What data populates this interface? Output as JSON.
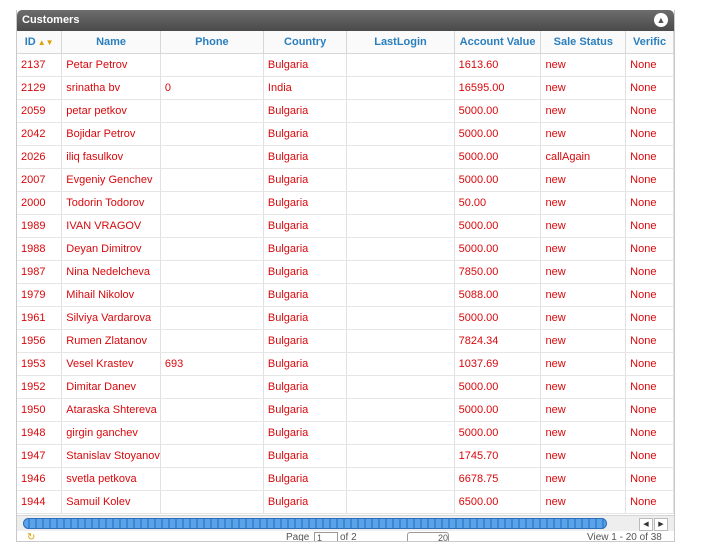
{
  "panel": {
    "title": "Customers"
  },
  "columns": [
    {
      "key": "id",
      "label": "ID"
    },
    {
      "key": "name",
      "label": "Name"
    },
    {
      "key": "phone",
      "label": "Phone"
    },
    {
      "key": "country",
      "label": "Country"
    },
    {
      "key": "lastlogin",
      "label": "LastLogin"
    },
    {
      "key": "account",
      "label": "Account Value"
    },
    {
      "key": "status",
      "label": "Sale Status"
    },
    {
      "key": "verif",
      "label": "Verific"
    }
  ],
  "rows": [
    {
      "id": "2137",
      "name": "Petar  Petrov",
      "phone": "",
      "country": "Bulgaria",
      "lastlogin": "",
      "account": "1613.60",
      "status": "new",
      "verif": "None"
    },
    {
      "id": "2129",
      "name": "srinatha bv",
      "phone": "0",
      "country": "India",
      "lastlogin": "",
      "account": "16595.00",
      "status": "new",
      "verif": "None"
    },
    {
      "id": "2059",
      "name": "petar petkov",
      "phone": "",
      "country": "Bulgaria",
      "lastlogin": "",
      "account": "5000.00",
      "status": "new",
      "verif": "None"
    },
    {
      "id": "2042",
      "name": "Bojidar Petrov",
      "phone": "",
      "country": "Bulgaria",
      "lastlogin": "",
      "account": "5000.00",
      "status": "new",
      "verif": "None"
    },
    {
      "id": "2026",
      "name": "iliq fasulkov",
      "phone": "",
      "country": "Bulgaria",
      "lastlogin": "",
      "account": "5000.00",
      "status": "callAgain",
      "verif": "None"
    },
    {
      "id": "2007",
      "name": "Evgeniy Genchev",
      "phone": "",
      "country": "Bulgaria",
      "lastlogin": "",
      "account": "5000.00",
      "status": "new",
      "verif": "None"
    },
    {
      "id": "2000",
      "name": "Todorin  Todorov",
      "phone": "",
      "country": "Bulgaria",
      "lastlogin": "",
      "account": "50.00",
      "status": "new",
      "verif": "None"
    },
    {
      "id": "1989",
      "name": "IVAN VRAGOV",
      "phone": "",
      "country": "Bulgaria",
      "lastlogin": "",
      "account": "5000.00",
      "status": "new",
      "verif": "None"
    },
    {
      "id": "1988",
      "name": "Deyan Dimitrov",
      "phone": "",
      "country": "Bulgaria",
      "lastlogin": "",
      "account": "5000.00",
      "status": "new",
      "verif": "None"
    },
    {
      "id": "1987",
      "name": "Nina Nedelcheva",
      "phone": "",
      "country": "Bulgaria",
      "lastlogin": "",
      "account": "7850.00",
      "status": "new",
      "verif": "None"
    },
    {
      "id": "1979",
      "name": "Mihail Nikolov",
      "phone": "",
      "country": "Bulgaria",
      "lastlogin": "",
      "account": "5088.00",
      "status": "new",
      "verif": "None"
    },
    {
      "id": "1961",
      "name": "Silviya Vardarova",
      "phone": "",
      "country": "Bulgaria",
      "lastlogin": "",
      "account": "5000.00",
      "status": "new",
      "verif": "None"
    },
    {
      "id": "1956",
      "name": "Rumen Zlatanov",
      "phone": "",
      "country": "Bulgaria",
      "lastlogin": "",
      "account": "7824.34",
      "status": "new",
      "verif": "None"
    },
    {
      "id": "1953",
      "name": "Vesel Krastev",
      "phone": "693",
      "country": "Bulgaria",
      "lastlogin": "",
      "account": "1037.69",
      "status": "new",
      "verif": "None"
    },
    {
      "id": "1952",
      "name": "Dimitar Danev",
      "phone": "",
      "country": "Bulgaria",
      "lastlogin": "",
      "account": "5000.00",
      "status": "new",
      "verif": "None"
    },
    {
      "id": "1950",
      "name": "Ataraska Shtereva",
      "phone": "",
      "country": "Bulgaria",
      "lastlogin": "",
      "account": "5000.00",
      "status": "new",
      "verif": "None"
    },
    {
      "id": "1948",
      "name": "girgin ganchev",
      "phone": "",
      "country": "Bulgaria",
      "lastlogin": "",
      "account": "5000.00",
      "status": "new",
      "verif": "None"
    },
    {
      "id": "1947",
      "name": "Stanislav Stoyanov",
      "phone": "",
      "country": "Bulgaria",
      "lastlogin": "",
      "account": "1745.70",
      "status": "new",
      "verif": "None"
    },
    {
      "id": "1946",
      "name": "svetla petkova",
      "phone": "",
      "country": "Bulgaria",
      "lastlogin": "",
      "account": "6678.75",
      "status": "new",
      "verif": "None"
    },
    {
      "id": "1944",
      "name": "Samuil Kolev",
      "phone": "",
      "country": "Bulgaria",
      "lastlogin": "",
      "account": "6500.00",
      "status": "new",
      "verif": "None"
    }
  ],
  "pager": {
    "page_label": "Page",
    "page_value": "1",
    "of_label": "of 2",
    "rows_value": "20",
    "view_label": "View 1 - 20 of 38"
  },
  "icons": {
    "collapse": "collapse-up-icon",
    "sort": "sort-arrows-icon",
    "refresh": "refresh-icon"
  }
}
